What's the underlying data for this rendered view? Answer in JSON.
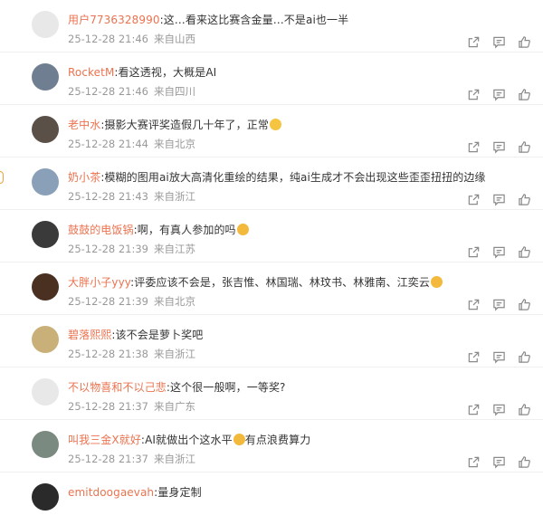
{
  "comments": [
    {
      "user": "用户7736328990",
      "text": ":这…看来这比赛含金量…不是ai也一半",
      "emoji": "",
      "text_after": "",
      "time": "25-12-28 21:46",
      "location": "来自山西",
      "avatar_color": "#e8e8e8"
    },
    {
      "user": "RocketM",
      "text": ":看这透视，大概是AI",
      "emoji": "",
      "text_after": "",
      "time": "25-12-28 21:46",
      "location": "来自四川",
      "avatar_color": "#6f7f91"
    },
    {
      "user": "老中水",
      "text": ":摄影大赛评奖造假几十年了，正常",
      "emoji": "laugh-cry-emoji",
      "text_after": "",
      "time": "25-12-28 21:44",
      "location": "来自北京",
      "avatar_color": "#5a5048"
    },
    {
      "user": "奶小茶",
      "text": ":模糊的图用ai放大高清化重绘的结果，纯ai生成才不会出现这些歪歪扭扭的边缘",
      "emoji": "",
      "text_after": "",
      "time": "25-12-28 21:43",
      "location": "来自浙江",
      "avatar_color": "#8aa0b8"
    },
    {
      "user": "鼓鼓的电饭锅",
      "text": ":啊，有真人参加的吗",
      "emoji": "smirk-emoji",
      "text_after": "",
      "time": "25-12-28 21:39",
      "location": "来自江苏",
      "avatar_color": "#3a3a3a"
    },
    {
      "user": "大胖小子yyy",
      "text": ":评委应该不会是，张吉惟、林国瑞、林玟书、林雅南、江奕云",
      "emoji": "smirk-emoji",
      "text_after": "",
      "time": "25-12-28 21:39",
      "location": "来自北京",
      "avatar_color": "#4a3020"
    },
    {
      "user": "碧落熙熙",
      "text": ":该不会是萝卜奖吧",
      "emoji": "",
      "text_after": "",
      "time": "25-12-28 21:38",
      "location": "来自浙江",
      "avatar_color": "#c8b078"
    },
    {
      "user": "不以物喜和不以己悲",
      "text": ":这个很一般啊，一等奖?",
      "emoji": "",
      "text_after": "",
      "time": "25-12-28 21:37",
      "location": "来自广东",
      "avatar_color": "#e8e8e8"
    },
    {
      "user": "叫我三金X就好",
      "text": ":AI就做出个这水平",
      "emoji": "smirk-emoji",
      "text_after": "有点浪费算力",
      "time": "25-12-28 21:37",
      "location": "来自浙江",
      "avatar_color": "#7a8a80"
    },
    {
      "user": "emitdoogaevah",
      "text": ":量身定制",
      "emoji": "",
      "text_after": "",
      "time": "",
      "location": "",
      "avatar_color": "#2a2a2a"
    }
  ]
}
